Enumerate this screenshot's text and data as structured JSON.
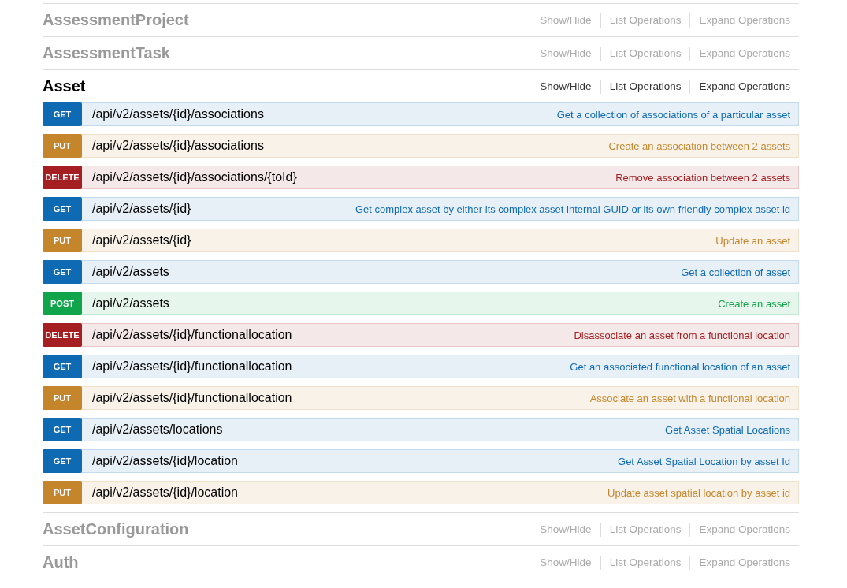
{
  "sections": [
    {
      "name": "AssessmentProject",
      "expanded": false,
      "links": [
        "Show/Hide",
        "List Operations",
        "Expand Operations"
      ]
    },
    {
      "name": "AssessmentTask",
      "expanded": false,
      "links": [
        "Show/Hide",
        "List Operations",
        "Expand Operations"
      ]
    },
    {
      "name": "Asset",
      "expanded": true,
      "links": [
        "Show/Hide",
        "List Operations",
        "Expand Operations"
      ],
      "operations": [
        {
          "kind": "get",
          "method": "GET",
          "path": "/api/v2/assets/{id}/associations",
          "summary": "Get a collection of associations of a particular asset"
        },
        {
          "kind": "put",
          "method": "PUT",
          "path": "/api/v2/assets/{id}/associations",
          "summary": "Create an association between 2 assets"
        },
        {
          "kind": "delete",
          "method": "DELETE",
          "path": "/api/v2/assets/{id}/associations/{toId}",
          "summary": "Remove association between 2 assets"
        },
        {
          "kind": "get",
          "method": "GET",
          "path": "/api/v2/assets/{id}",
          "summary": "Get complex asset by either its complex asset internal GUID or its own friendly complex asset id"
        },
        {
          "kind": "put",
          "method": "PUT",
          "path": "/api/v2/assets/{id}",
          "summary": "Update an asset"
        },
        {
          "kind": "get",
          "method": "GET",
          "path": "/api/v2/assets",
          "summary": "Get a collection of asset"
        },
        {
          "kind": "post",
          "method": "POST",
          "path": "/api/v2/assets",
          "summary": "Create an asset"
        },
        {
          "kind": "delete",
          "method": "DELETE",
          "path": "/api/v2/assets/{id}/functionallocation",
          "summary": "Disassociate an asset from a functional location"
        },
        {
          "kind": "get",
          "method": "GET",
          "path": "/api/v2/assets/{id}/functionallocation",
          "summary": "Get an associated functional location of an asset"
        },
        {
          "kind": "put",
          "method": "PUT",
          "path": "/api/v2/assets/{id}/functionallocation",
          "summary": "Associate an asset with a functional location"
        },
        {
          "kind": "get",
          "method": "GET",
          "path": "/api/v2/assets/locations",
          "summary": "Get Asset Spatial Locations"
        },
        {
          "kind": "get",
          "method": "GET",
          "path": "/api/v2/assets/{id}/location",
          "summary": "Get Asset Spatial Location by asset Id"
        },
        {
          "kind": "put",
          "method": "PUT",
          "path": "/api/v2/assets/{id}/location",
          "summary": "Update asset spatial location by asset id"
        }
      ]
    },
    {
      "name": "AssetConfiguration",
      "expanded": false,
      "links": [
        "Show/Hide",
        "List Operations",
        "Expand Operations"
      ]
    },
    {
      "name": "Auth",
      "expanded": false,
      "links": [
        "Show/Hide",
        "List Operations",
        "Expand Operations"
      ]
    }
  ]
}
